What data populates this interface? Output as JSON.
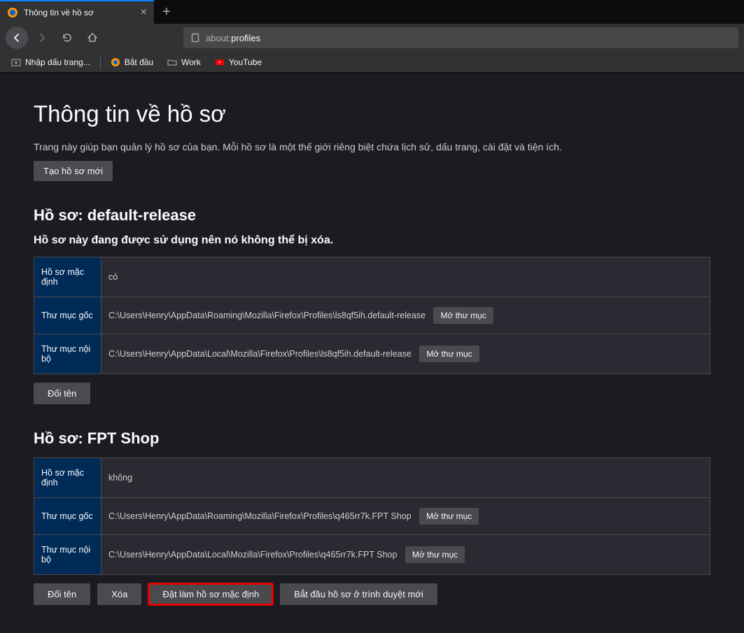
{
  "tab": {
    "title": "Thông tin về hồ sơ"
  },
  "url": {
    "scheme": "about:",
    "path": "profiles"
  },
  "bookmarks": {
    "import": "Nhập dấu trang...",
    "start": "Bắt đầu",
    "work": "Work",
    "youtube": "YouTube"
  },
  "page": {
    "title": "Thông tin về hồ sơ",
    "desc": "Trang này giúp bạn quản lý hồ sơ của bạn. Mỗi hồ sơ là một thế giới riêng biệt chứa lịch sử, dấu trang, cài đặt và tiện ích.",
    "create_btn": "Tạo hồ sơ mới"
  },
  "labels": {
    "default_profile": "Hồ sơ mặc định",
    "root_dir": "Thư mục gốc",
    "local_dir": "Thư mục nội bộ",
    "open_folder": "Mở thư mục",
    "rename": "Đổi tên",
    "delete": "Xóa",
    "set_default": "Đặt làm hồ sơ mặc định",
    "launch_new": "Bắt đầu hồ sơ ở trình duyệt mới",
    "yes": "có",
    "no": "không"
  },
  "profiles": [
    {
      "heading": "Hồ sơ: default-release",
      "note": "Hồ sơ này đang được sử dụng nên nó không thể bị xóa.",
      "is_default": true,
      "root": "C:\\Users\\Henry\\AppData\\Roaming\\Mozilla\\Firefox\\Profiles\\ls8qf5ih.default-release",
      "local": "C:\\Users\\Henry\\AppData\\Local\\Mozilla\\Firefox\\Profiles\\ls8qf5ih.default-release"
    },
    {
      "heading": "Hồ sơ: FPT Shop",
      "note": "",
      "is_default": false,
      "root": "C:\\Users\\Henry\\AppData\\Roaming\\Mozilla\\Firefox\\Profiles\\q465rr7k.FPT Shop",
      "local": "C:\\Users\\Henry\\AppData\\Local\\Mozilla\\Firefox\\Profiles\\q465rr7k.FPT Shop"
    }
  ]
}
